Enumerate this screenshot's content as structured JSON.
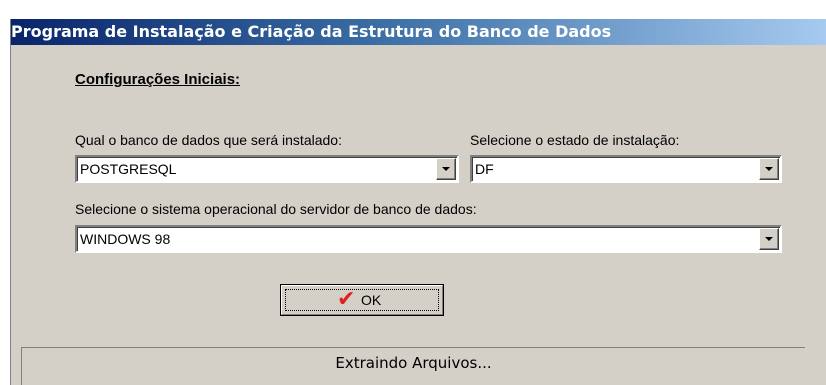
{
  "window": {
    "title": "Programa de Instalação e Criação da Estrutura do Banco de Dados"
  },
  "form": {
    "heading": "Configurações Iniciais:",
    "database_label": "Qual o banco de dados que será instalado:",
    "database_value": "POSTGRESQL",
    "state_label": "Selecione o estado de instalação:",
    "state_value": "DF",
    "os_label": "Selecione o sistema operacional do servidor de banco de dados:",
    "os_value": "WINDOWS 98"
  },
  "buttons": {
    "ok_label": "OK",
    "ok_icon": "checkmark-icon"
  },
  "status": {
    "text": "Extraindo Arquivos..."
  },
  "colors": {
    "title_gradient_start": "#0a246a",
    "title_gradient_end": "#a6caf0",
    "face": "#d4d0c8",
    "check": "#e02020"
  }
}
